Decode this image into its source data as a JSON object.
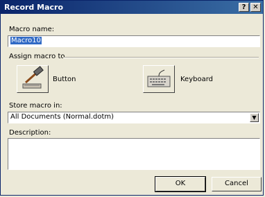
{
  "window": {
    "title": "Record Macro",
    "help_glyph": "?",
    "close_glyph": "✕"
  },
  "macro_name": {
    "label": "Macro name:",
    "value": "Macro10"
  },
  "assign": {
    "label": "Assign macro to",
    "button_label": "Button",
    "keyboard_label": "Keyboard"
  },
  "store": {
    "label": "Store macro in:",
    "value": "All Documents (Normal.dotm)"
  },
  "description": {
    "label": "Description:",
    "value": ""
  },
  "buttons": {
    "ok": "OK",
    "cancel": "Cancel"
  },
  "icons": {
    "button_option": "hammer-icon",
    "keyboard_option": "keyboard-icon"
  }
}
